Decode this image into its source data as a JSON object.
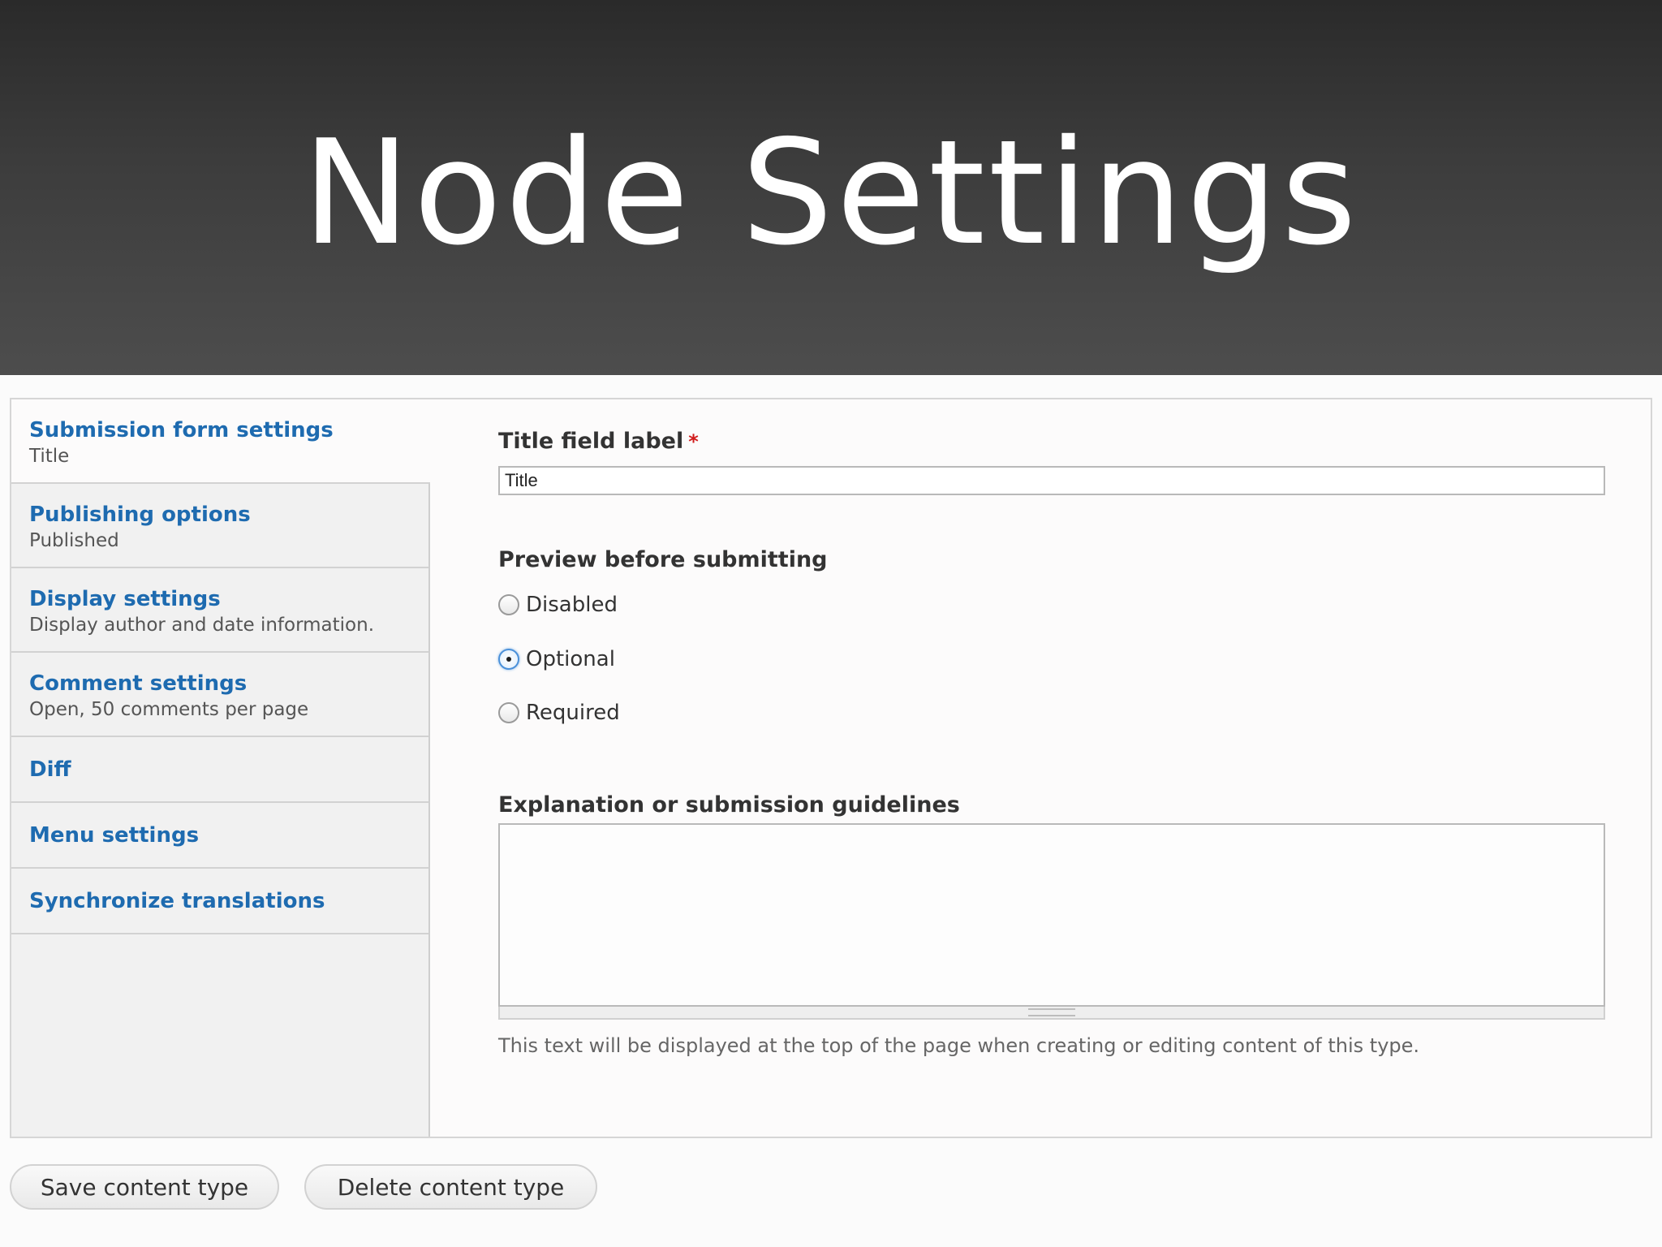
{
  "banner": {
    "title": "Node Settings"
  },
  "tabs": [
    {
      "title": "Submission form settings",
      "summary": "Title"
    },
    {
      "title": "Publishing options",
      "summary": "Published"
    },
    {
      "title": "Display settings",
      "summary": "Display author and date information."
    },
    {
      "title": "Comment settings",
      "summary": "Open, 50 comments per page"
    },
    {
      "title": "Diff"
    },
    {
      "title": "Menu settings"
    },
    {
      "title": "Synchronize translations"
    }
  ],
  "form": {
    "title_field_label": "Title field label",
    "required_mark": "*",
    "title_field_value": "Title",
    "preview_label": "Preview before submitting",
    "preview_options": [
      "Disabled",
      "Optional",
      "Required"
    ],
    "preview_selected": "Optional",
    "explanation_label": "Explanation or submission guidelines",
    "explanation_value": "",
    "explanation_description": "This text will be displayed at the top of the page when creating or editing content of this type."
  },
  "buttons": {
    "save": "Save content type",
    "delete": "Delete content type"
  },
  "colors": {
    "tab_link": "#1e6bb0",
    "required": "#d11b1b",
    "radio_selected": "#4a90d9"
  }
}
